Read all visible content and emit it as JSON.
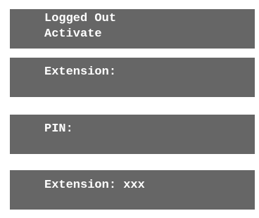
{
  "screens": [
    {
      "lines": [
        "Logged Out",
        "Activate"
      ]
    },
    {
      "lines": [
        "Extension:"
      ]
    },
    {
      "lines": [
        "PIN:"
      ]
    },
    {
      "lines": [
        "Extension: xxx"
      ]
    }
  ],
  "colors": {
    "panel_background": "#666666",
    "panel_text": "#ffffff",
    "page_background": "#ffffff"
  }
}
